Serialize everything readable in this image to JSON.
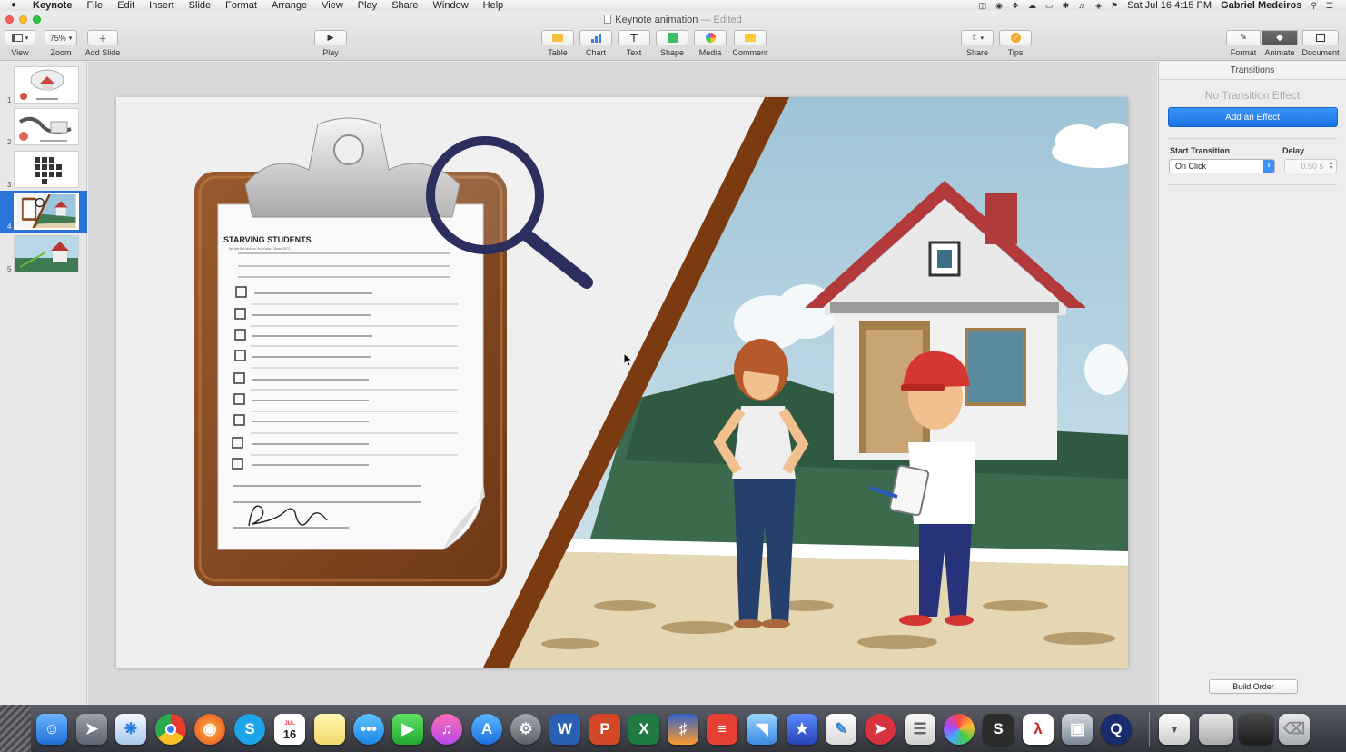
{
  "menubar": {
    "apple": "",
    "app": "Keynote",
    "items": [
      "File",
      "Edit",
      "Insert",
      "Slide",
      "Format",
      "Arrange",
      "View",
      "Play",
      "Share",
      "Window",
      "Help"
    ],
    "datetime": "Sat Jul 16  4:15 PM",
    "user": "Gabriel Medeiros"
  },
  "window": {
    "title": "Keynote animation",
    "dash": "—",
    "status": "Edited"
  },
  "toolbar": {
    "view_label": "View",
    "zoom_value": "75%",
    "zoom_label": "Zoom",
    "add_slide_label": "Add Slide",
    "play_label": "Play",
    "table_label": "Table",
    "chart_label": "Chart",
    "text_label": "Text",
    "shape_label": "Shape",
    "media_label": "Media",
    "comment_label": "Comment",
    "share_label": "Share",
    "tips_label": "Tips",
    "format_label": "Format",
    "animate_label": "Animate",
    "document_label": "Document",
    "text_icon_glyph": "T",
    "tips_icon_glyph": "?",
    "add_icon_glyph": "+",
    "play_icon_glyph": "▶"
  },
  "navigator": {
    "slides": [
      {
        "number": "1"
      },
      {
        "number": "2"
      },
      {
        "number": "3"
      },
      {
        "number": "4",
        "selected": true
      },
      {
        "number": "5"
      }
    ]
  },
  "slide": {
    "brand_text": "STARVING STUDENTS",
    "brand_tagline": "We Are the Movers You Know · Since 1973"
  },
  "inspector": {
    "header": "Transitions",
    "no_effect": "No Transition Effect",
    "add_effect": "Add an Effect",
    "start_transition_label": "Start Transition",
    "start_transition_value": "On Click",
    "delay_label": "Delay",
    "delay_value": "0.50 s",
    "build_order": "Build Order"
  },
  "dock": {
    "calendar_month": "JUL",
    "calendar_day": "16"
  },
  "colors": {
    "accent": "#1c72e6",
    "selection": "#2a74d9",
    "brown_stripe": "#7b3a10"
  }
}
